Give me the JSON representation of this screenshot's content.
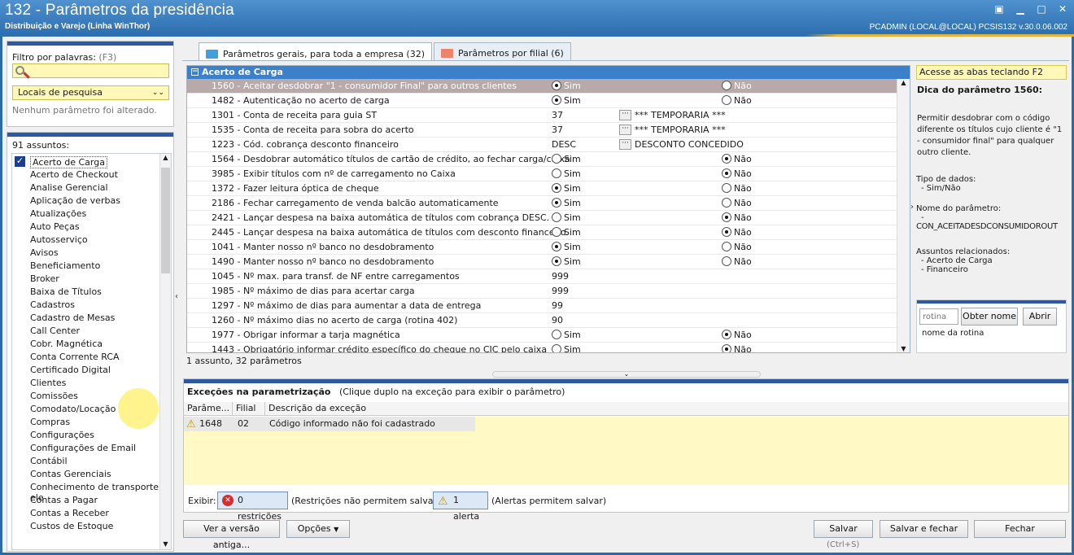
{
  "window": {
    "title": "132 - Parâmetros da presidência",
    "subtitle": "Distribuição e Varejo (Linha WinThor)",
    "status": "PCADMIN (LOCAL@LOCAL)   PCSIS132  v.30.0.06.002"
  },
  "filter": {
    "label": "Filtro por palavras:",
    "shortcut": "(F3)",
    "value": "",
    "locais": "Locais de pesquisa",
    "none_changed": "Nenhum parâmetro foi alterado."
  },
  "subjects": {
    "count_label": "91 assuntos:",
    "items": [
      "Acerto de Carga",
      "Acerto de Checkout",
      "Analise Gerencial",
      "Aplicação de verbas",
      "Atualizações",
      "Auto Peças",
      "Autosserviço",
      "Avisos",
      "Beneficiamento",
      "Broker",
      "Baixa de Títulos",
      "Cadastros",
      "Cadastro de Mesas",
      "Call Center",
      "Cobr. Magnética",
      "Conta Corrente RCA",
      "Certificado Digital",
      "Clientes",
      "Comissões",
      "Comodato/Locação",
      "Compras",
      "Configurações",
      "Configurações de Email",
      "Contábil",
      "Contas Gerenciais",
      "Conhecimento de transporte ele",
      "Contas a Pagar",
      "Contas a Receber",
      "Custos de Estoque"
    ]
  },
  "tabs": [
    {
      "label": "Parâmetros gerais, para toda a empresa (32)"
    },
    {
      "label": "Parâmetros por filial  (6)"
    }
  ],
  "grid": {
    "group": "Acerto de Carga",
    "yes": "Sim",
    "no": "Não",
    "rows": [
      {
        "text": "1560 - Aceitar desdobrar \"1 - consumidor Final\" para outros clientes",
        "type": "radio",
        "value": "Sim"
      },
      {
        "text": "1482 - Autenticação no acerto de carga",
        "type": "radio",
        "value": "Sim"
      },
      {
        "text": "1301 - Conta de receita para guia ST",
        "type": "lookup",
        "value": "37",
        "desc": "*** TEMPORARIA ***"
      },
      {
        "text": "1535 - Conta de receita para sobra do acerto",
        "type": "lookup",
        "value": "37",
        "desc": "*** TEMPORARIA ***"
      },
      {
        "text": "1223 - Cód. cobrança desconto financeiro",
        "type": "lookup",
        "value": "DESC",
        "desc": "DESCONTO CONCEDIDO"
      },
      {
        "text": "1564 - Desdobrar automático títulos de cartão de crédito, ao fechar carga/caixa",
        "type": "radio",
        "value": "Não"
      },
      {
        "text": "3985 - Exibir títulos com nº de carregamento no Caixa",
        "type": "radio",
        "value": "Não"
      },
      {
        "text": "1372 - Fazer leitura óptica de cheque",
        "type": "radio",
        "value": "Sim"
      },
      {
        "text": "2186 - Fechar carregamento de venda balcão automaticamente",
        "type": "radio",
        "value": "Sim"
      },
      {
        "text": "2421 - Lançar despesa na baixa automática de títulos com cobrança DESC.",
        "type": "radio",
        "value": "Não"
      },
      {
        "text": "2445 - Lançar despesa na baixa automática de títulos com desconto financeiro.",
        "type": "radio",
        "value": "Não"
      },
      {
        "text": "1041 - Manter nosso nº banco no desdobramento",
        "type": "radio",
        "value": "Sim"
      },
      {
        "text": "1490 - Manter nosso nº banco no desdobramento",
        "type": "radio",
        "value": "Sim"
      },
      {
        "text": "1045 - Nº max. para transf. de NF entre carregamentos",
        "type": "value",
        "value": "999"
      },
      {
        "text": "1985 - Nº máximo de dias para acertar carga",
        "type": "value",
        "value": "999"
      },
      {
        "text": "1297 - Nº máximo de dias para aumentar a data de entrega",
        "type": "value",
        "value": "99"
      },
      {
        "text": "1260 - Nº máximo dias no acerto de carga (rotina 402)",
        "type": "value",
        "value": "90"
      },
      {
        "text": "1977 - Obrigar informar a tarja magnética",
        "type": "radio",
        "value": "Não"
      },
      {
        "text": "1443 - Obrigatório informar crédito específico do cheque no CIC pelo caixa",
        "type": "radio",
        "value": "Não"
      }
    ],
    "footer": "1 assunto, 32 parâmetros"
  },
  "tip": {
    "banner": "Acesse as abas teclando F2",
    "title": "Dica do parâmetro 1560:",
    "body": "Permitir desdobrar com o código diferente os títulos cujo cliente é \"1 - consumidor final\" para qualquer outro cliente.",
    "type_label": "Tipo de dados:",
    "type_value": "- Sim/Não",
    "name_label": "Nome do parâmetro:",
    "name_dash": "-",
    "name_value": "CON_ACEITADESDCONSUMIDOROUT",
    "related_label": "Assuntos relacionados:",
    "related": [
      "- Acerto de Carga",
      "- Financeiro"
    ]
  },
  "rotina": {
    "placeholder": "rotina",
    "get_name": "Obter nome",
    "open": "Abrir",
    "name_label": "nome da rotina"
  },
  "exceptions": {
    "title": "Exceções na parametrização",
    "hint": "(Clique duplo na exceção para exibir o parâmetro)",
    "columns": [
      "Parâme...",
      "Filial",
      "Descrição da exceção"
    ],
    "rows": [
      {
        "param": "1648",
        "filial": "02",
        "desc": "Código informado não foi cadastrado"
      }
    ],
    "exibir": "Exibir:",
    "restrictions": "0 restrições",
    "restrictions_note": "(Restrições não permitem salvar)",
    "alerts": "1 alerta",
    "alerts_note": "(Alertas permitem salvar)"
  },
  "buttons": {
    "old_version": "Ver a versão antiga...",
    "options": "Opções",
    "save": "Salvar",
    "save_shortcut": "(Ctrl+S)",
    "save_close": "Salvar e fechar",
    "close": "Fechar"
  }
}
